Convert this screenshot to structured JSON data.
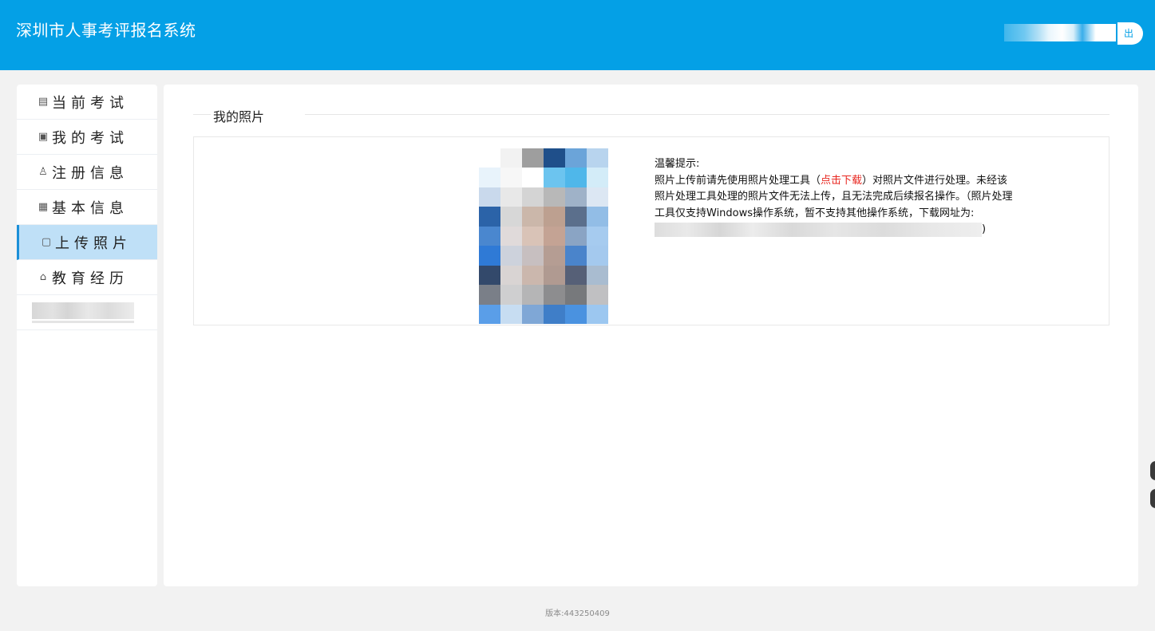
{
  "header": {
    "app_title": "深圳市人事考评报名系统",
    "logout_label": "出"
  },
  "sidebar": {
    "items": [
      {
        "icon": "exam-icon",
        "label": "当前考试",
        "active": false
      },
      {
        "icon": "my-exam-icon",
        "label": "我的考试",
        "active": false
      },
      {
        "icon": "user-icon",
        "label": "注册信息",
        "active": false
      },
      {
        "icon": "form-icon",
        "label": "基本信息",
        "active": false
      },
      {
        "icon": "photo-icon",
        "label": "上传照片",
        "active": true
      },
      {
        "icon": "graduation-icon",
        "label": "教育经历",
        "active": false
      }
    ]
  },
  "main": {
    "section_title": "我的照片",
    "tip": {
      "heading": "温馨提示:",
      "text_before_link": "照片上传前请先使用照片处理工具（",
      "link": "点击下载",
      "text_after_link": "）对照片文件进行处理。未经该照片处理工具处理的照片文件无法上传，且无法完成后续报名操作。（照片处理工具仅支持Windows操作系统，暂不支持其他操作系统，下载网址为:",
      "closing": ")"
    }
  },
  "footer": {
    "version": "版本:443250409"
  }
}
